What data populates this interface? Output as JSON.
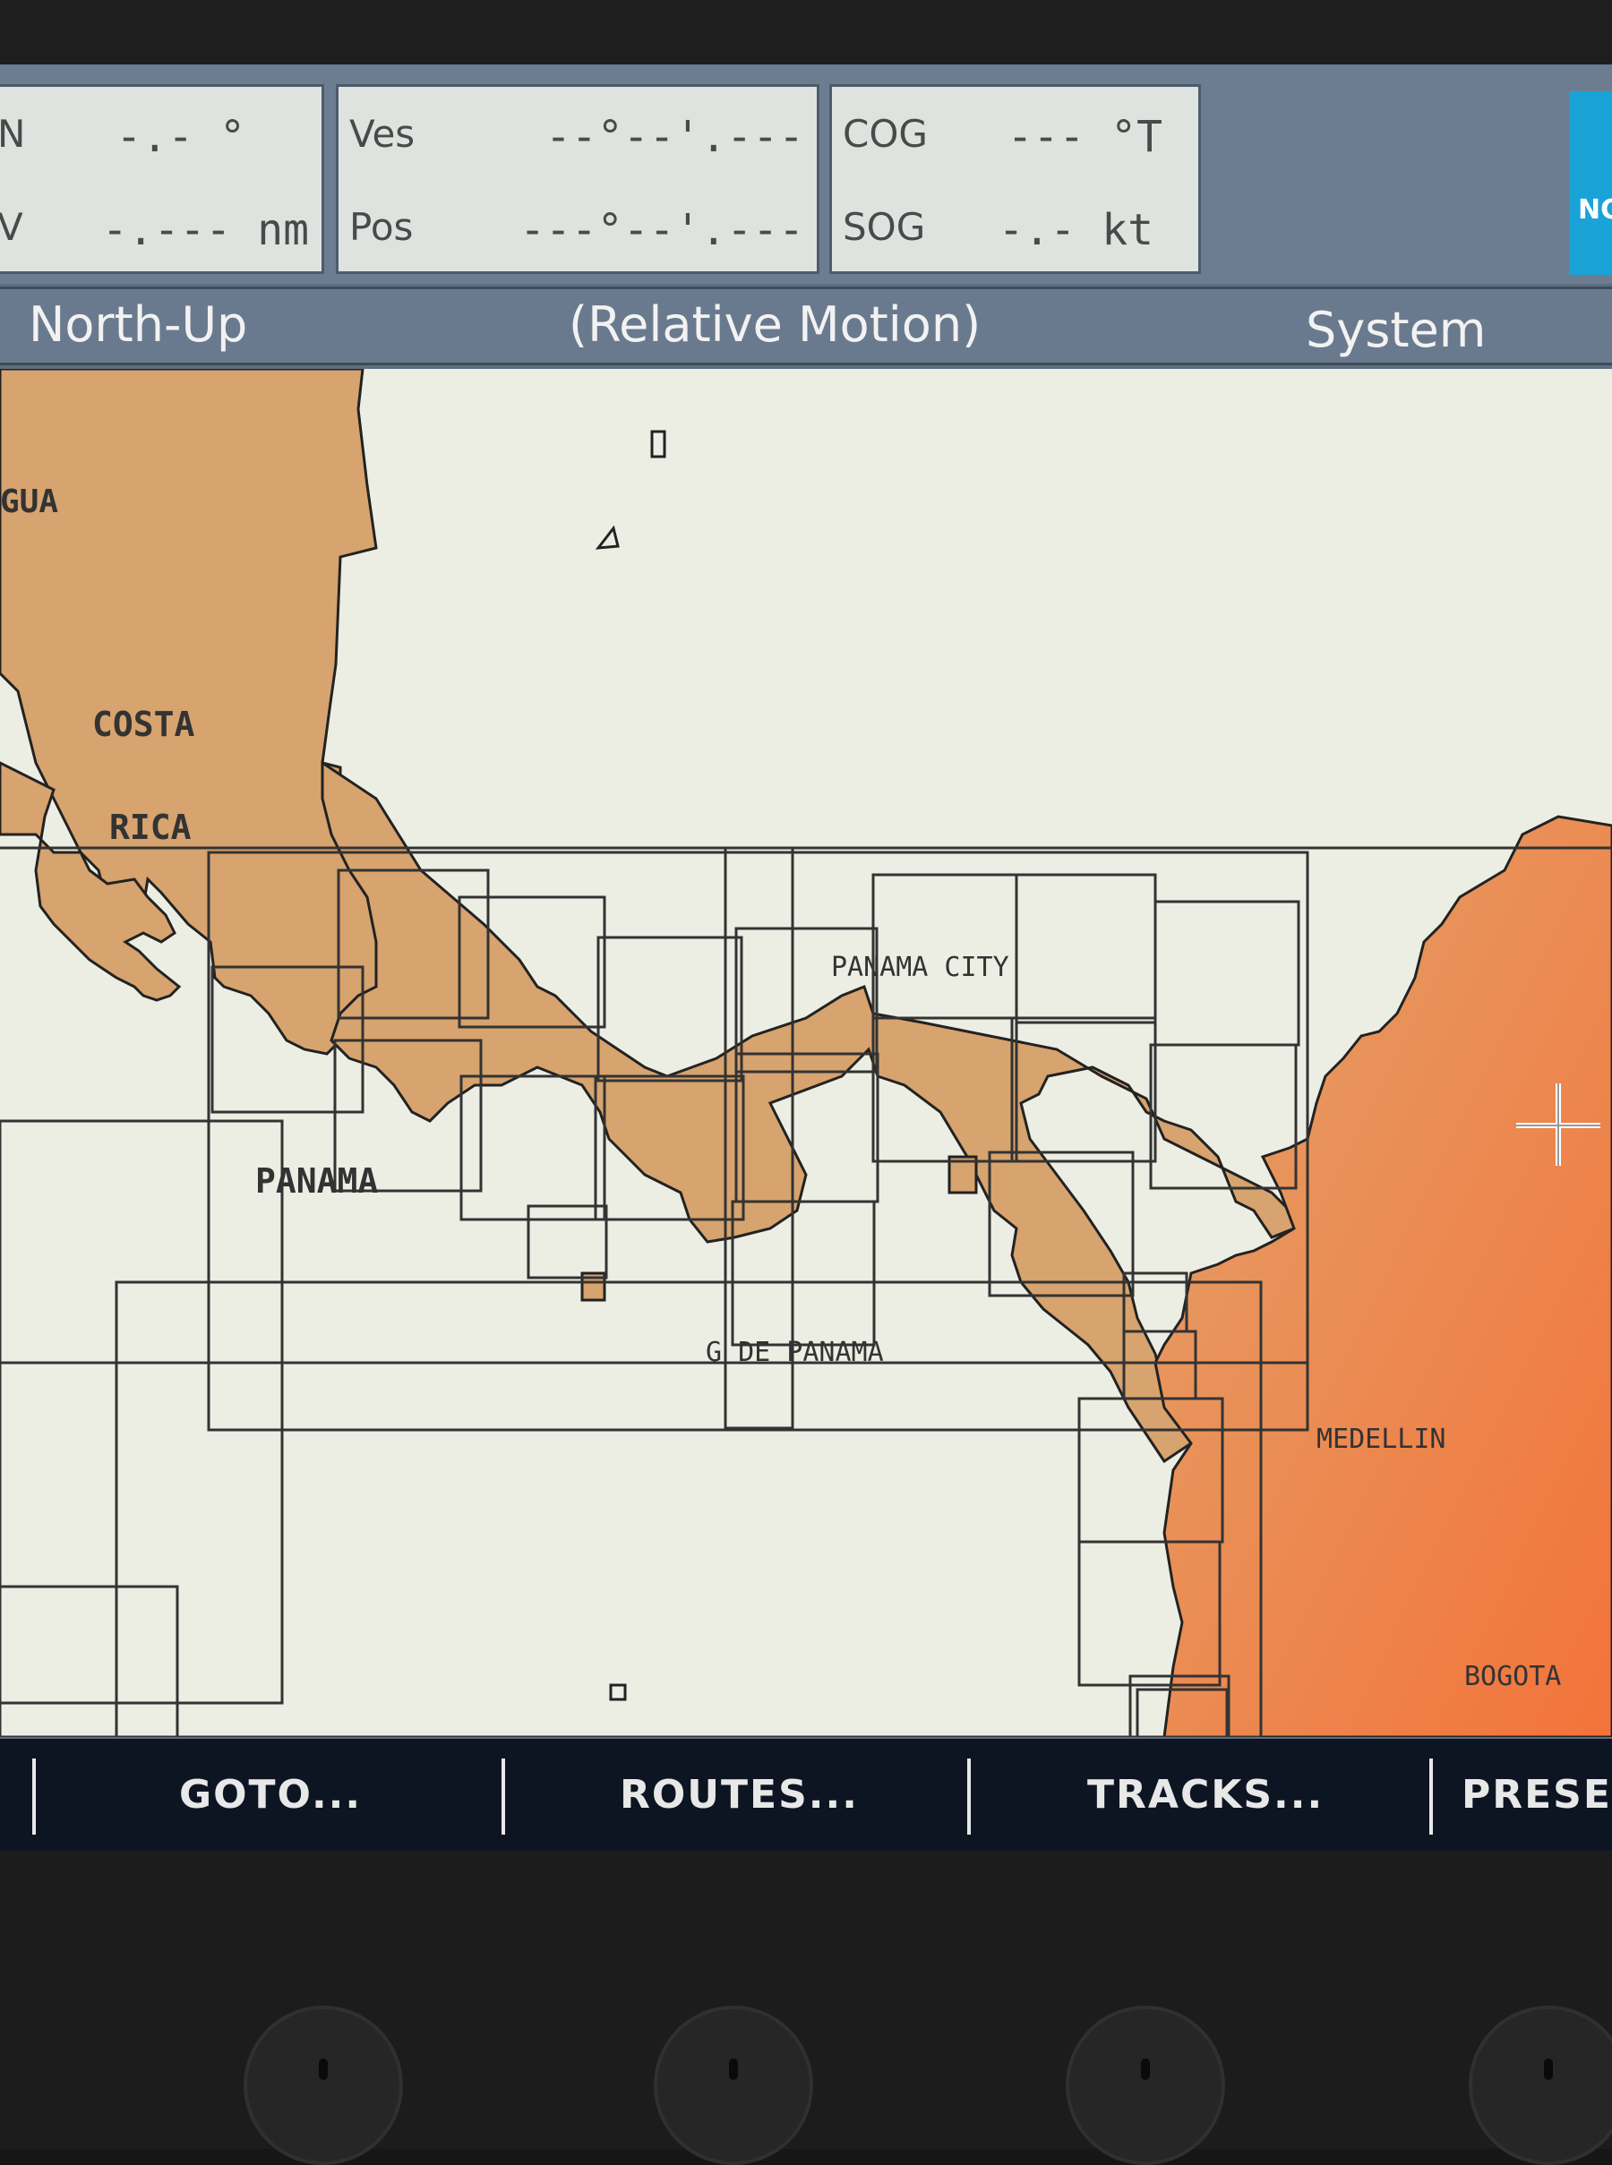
{
  "databar": {
    "box1": {
      "row1_label": "N",
      "row1_value": "-.- °",
      "row2_label": "V",
      "row2_value": "-.--- nm"
    },
    "box2": {
      "row1_label": "Ves",
      "row1_value": "--°--'.---",
      "row2_label": "Pos",
      "row2_value": "---°--'.---"
    },
    "box3": {
      "row1_label": "COG",
      "row1_value": "--- °T",
      "row2_label": "SOG",
      "row2_value": "-.- kt"
    },
    "logo_text": "NC"
  },
  "status": {
    "orientation": "North-Up",
    "motion": "(Relative Motion)",
    "source": "System"
  },
  "map": {
    "labels": {
      "nicaragua": "GUA",
      "costa": "COSTA",
      "rica": "RICA",
      "panama": "PANAMA",
      "panama_city": "PANAMA CITY",
      "golfo": "G DE PANAMA",
      "medellin": "MEDELLIN",
      "bogota": "BOGOTA"
    },
    "colors": {
      "land": "#d7a36e",
      "sea": "#eceee4",
      "colombia_start": "#e59b5c",
      "colombia_end": "#f07a3a",
      "grid": "#333333"
    }
  },
  "menu": {
    "goto": "GOTO...",
    "routes": "ROUTES...",
    "tracks": "TRACKS...",
    "preset": "PRESE"
  }
}
